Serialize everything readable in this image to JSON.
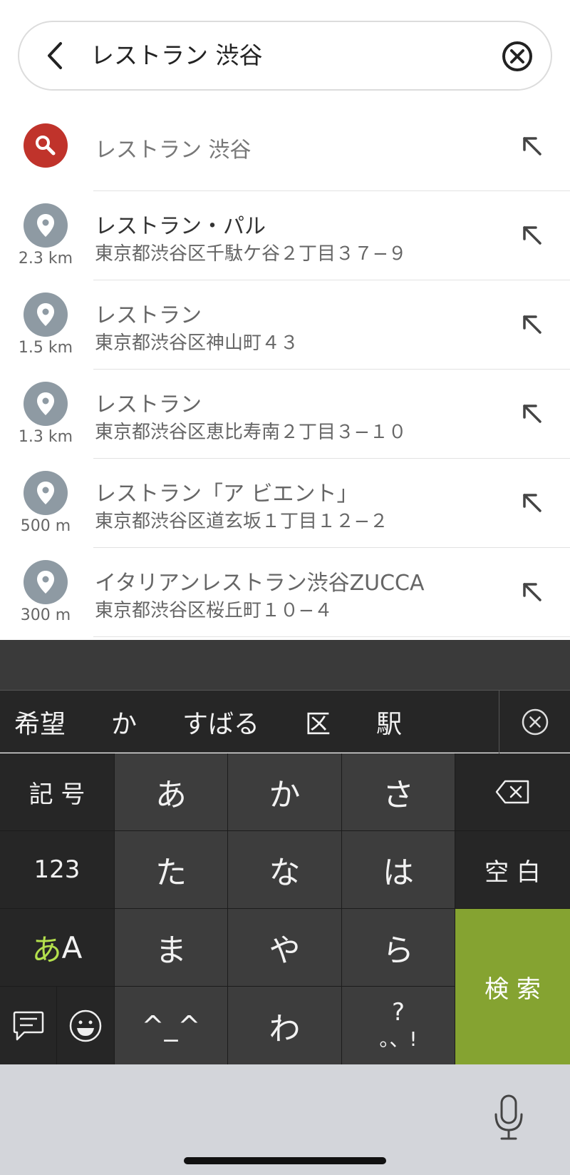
{
  "search": {
    "query": "レストラン 渋谷"
  },
  "suggestion": {
    "label": "レストラン 渋谷"
  },
  "results": [
    {
      "title": "レストラン・パル",
      "address": "東京都渋谷区千駄ケ谷２丁目３７−９",
      "distance": "2.3 km"
    },
    {
      "title": "レストラン",
      "address": "東京都渋谷区神山町４３",
      "distance": "1.5 km"
    },
    {
      "title": "レストラン",
      "address": "東京都渋谷区恵比寿南２丁目３−１０",
      "distance": "1.3 km"
    },
    {
      "title": "レストラン「ア ビエント」",
      "address": "東京都渋谷区道玄坂１丁目１２−２",
      "distance": "500 m"
    },
    {
      "title": "イタリアンレストラン渋谷ZUCCA",
      "address": "東京都渋谷区桜丘町１０−４",
      "distance": "300 m"
    }
  ],
  "keyboard": {
    "candidates": [
      "希望",
      "か",
      "すばる",
      "区",
      "駅"
    ],
    "keys": {
      "symbols": "記 号",
      "a": "あ",
      "ka": "か",
      "sa": "さ",
      "numbers": "123",
      "ta": "た",
      "na": "な",
      "ha": "は",
      "space": "空 白",
      "mode_a": "あ",
      "mode_A": "A",
      "ma": "ま",
      "ya": "や",
      "ra": "ら",
      "search": "検 索",
      "kaomoji": "^_^",
      "wa": "わ",
      "punct_top": "?",
      "punct_bottom": "。、!"
    }
  },
  "colors": {
    "search_accent": "#c0332b",
    "pin": "#8e9aa3",
    "enter_key": "#85a331"
  }
}
